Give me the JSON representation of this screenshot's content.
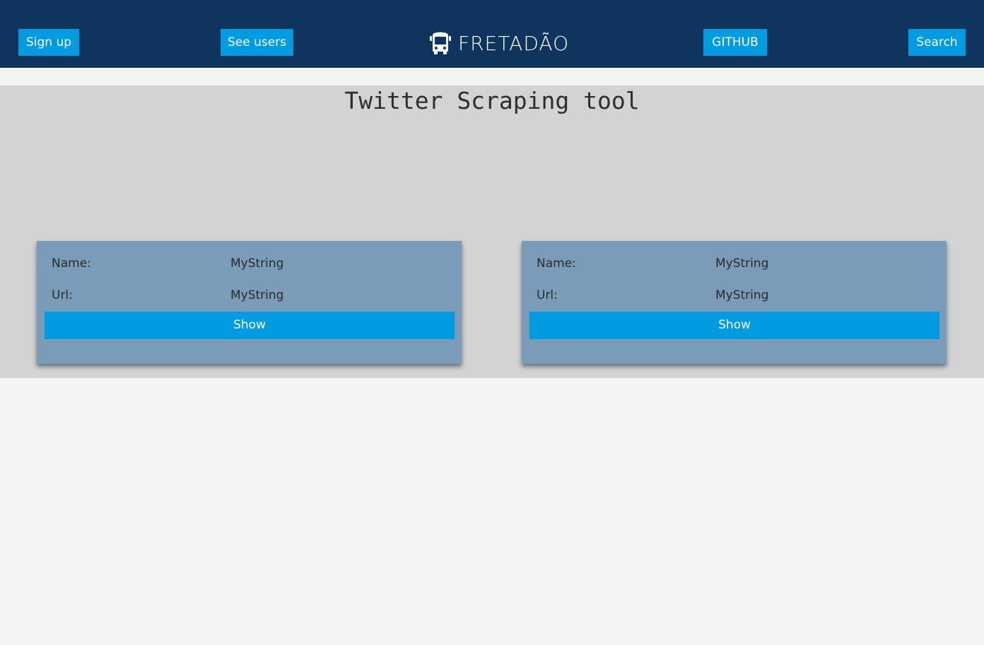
{
  "header": {
    "brand": "FRETADÃO",
    "brand_icon": "bus-icon",
    "nav": {
      "signup": "Sign up",
      "users": "See users",
      "github": "GITHUB",
      "search": "Search"
    }
  },
  "main": {
    "title": "Twitter Scraping tool",
    "cards": [
      {
        "name_label": "Name:",
        "name_value": "MyString",
        "url_label": "Url:",
        "url_value": "MyString",
        "button": "Show"
      },
      {
        "name_label": "Name:",
        "name_value": "MyString",
        "url_label": "Url:",
        "url_value": "MyString",
        "button": "Show"
      }
    ]
  },
  "colors": {
    "header_bg": "#0f345e",
    "accent": "#009be0",
    "panel_bg": "#d3d3d3",
    "card_bg": "#7b9cb8",
    "page_bg": "#f4f4f4"
  }
}
